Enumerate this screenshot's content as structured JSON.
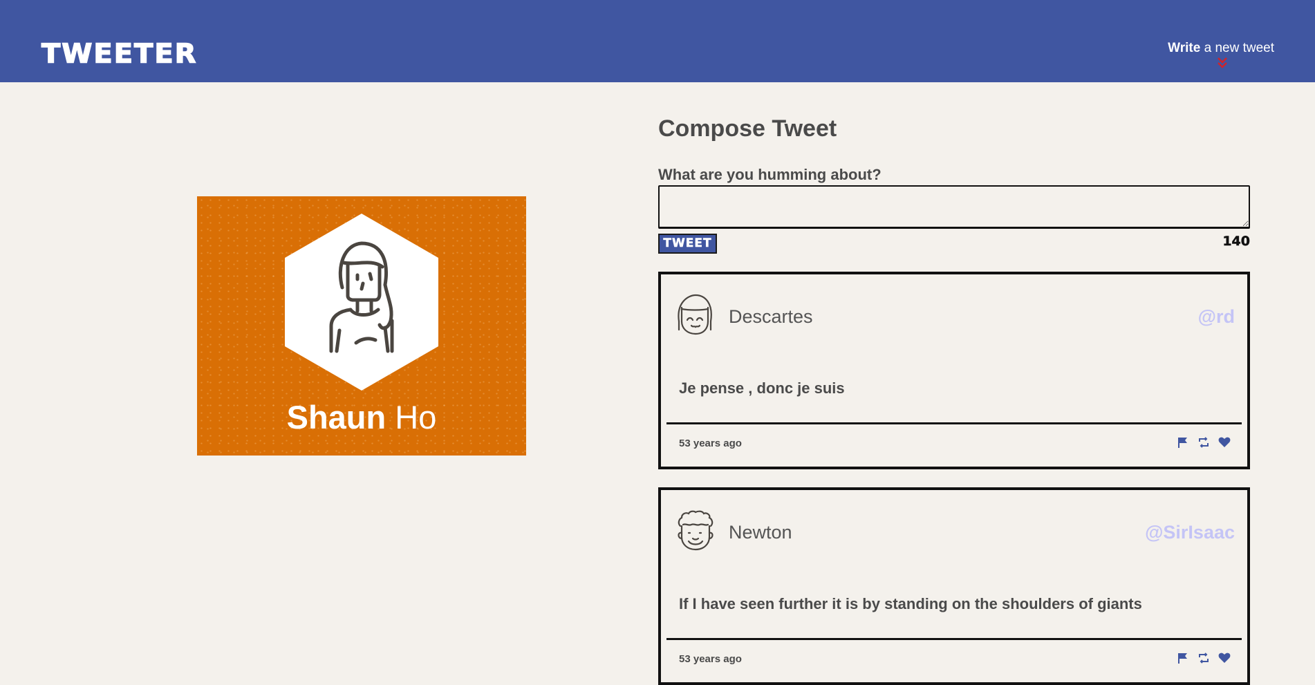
{
  "nav": {
    "logo": "TWEETER",
    "write_strong": "Write",
    "write_rest": " a new tweet",
    "toggle_icon": "double-chevron-down-icon",
    "toggle_color": "#d1232a",
    "bg_color": "#4056a1"
  },
  "profile": {
    "first_name": "Shaun",
    "last_name": "Ho",
    "bg_color": "#d96f05",
    "avatar_icon": "woman-avatar-icon"
  },
  "compose": {
    "title": "Compose Tweet",
    "label": "What are you humming about?",
    "input_value": "",
    "submit_label": "TWEET",
    "counter": "140"
  },
  "tweets": [
    {
      "name": "Descartes",
      "handle": "@rd",
      "content": "Je pense , donc je suis",
      "time": "53 years ago",
      "avatar_icon": "girl-avatar-icon"
    },
    {
      "name": "Newton",
      "handle": "@SirIsaac",
      "content": "If I have seen further it is by standing on the shoulders of giants",
      "time": "53 years ago",
      "avatar_icon": "curly-hair-avatar-icon"
    }
  ],
  "action_icons": [
    "flag-icon",
    "retweet-icon",
    "heart-icon"
  ],
  "colors": {
    "accent": "#4056a1",
    "handle": "#c4c4f6",
    "page_bg": "#f4f1ec"
  }
}
